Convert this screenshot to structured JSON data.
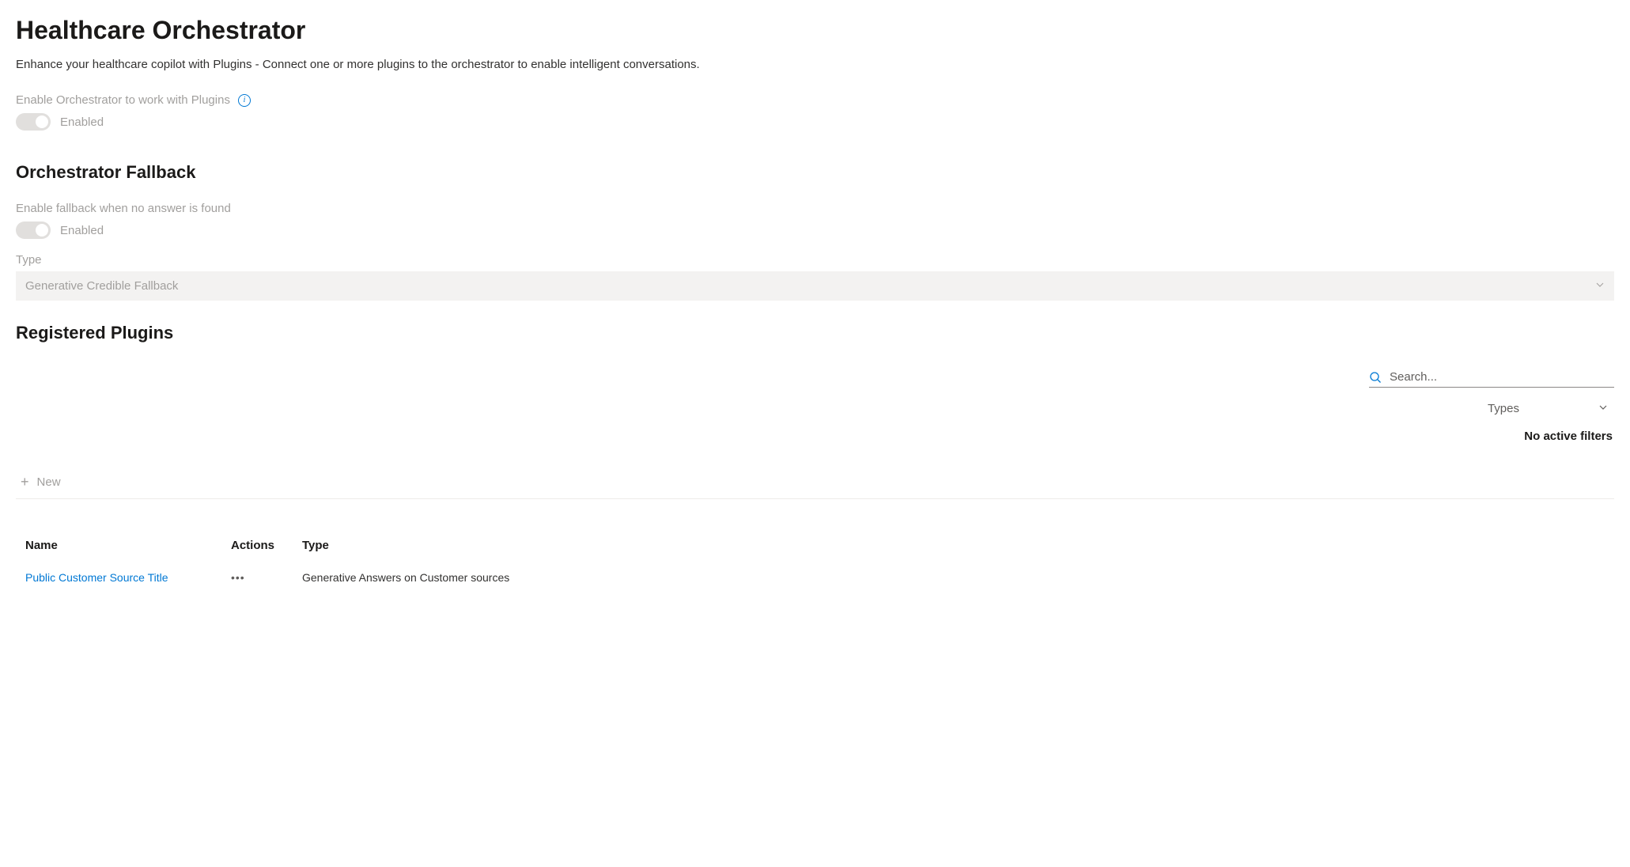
{
  "header": {
    "title": "Healthcare Orchestrator",
    "description": "Enhance your healthcare copilot with Plugins - Connect one or more plugins to the orchestrator to enable intelligent conversations."
  },
  "orchestrator": {
    "enable_label": "Enable Orchestrator to work with Plugins",
    "toggle_state": "Enabled"
  },
  "fallback": {
    "title": "Orchestrator Fallback",
    "enable_label": "Enable fallback when no answer is found",
    "toggle_state": "Enabled",
    "type_label": "Type",
    "type_value": "Generative Credible Fallback"
  },
  "plugins": {
    "title": "Registered Plugins",
    "search_placeholder": "Search...",
    "types_label": "Types",
    "no_filters": "No active filters",
    "new_button": "New",
    "columns": {
      "name": "Name",
      "actions": "Actions",
      "type": "Type"
    },
    "rows": [
      {
        "name": "Public Customer Source Title",
        "type": "Generative Answers on Customer sources"
      }
    ]
  }
}
